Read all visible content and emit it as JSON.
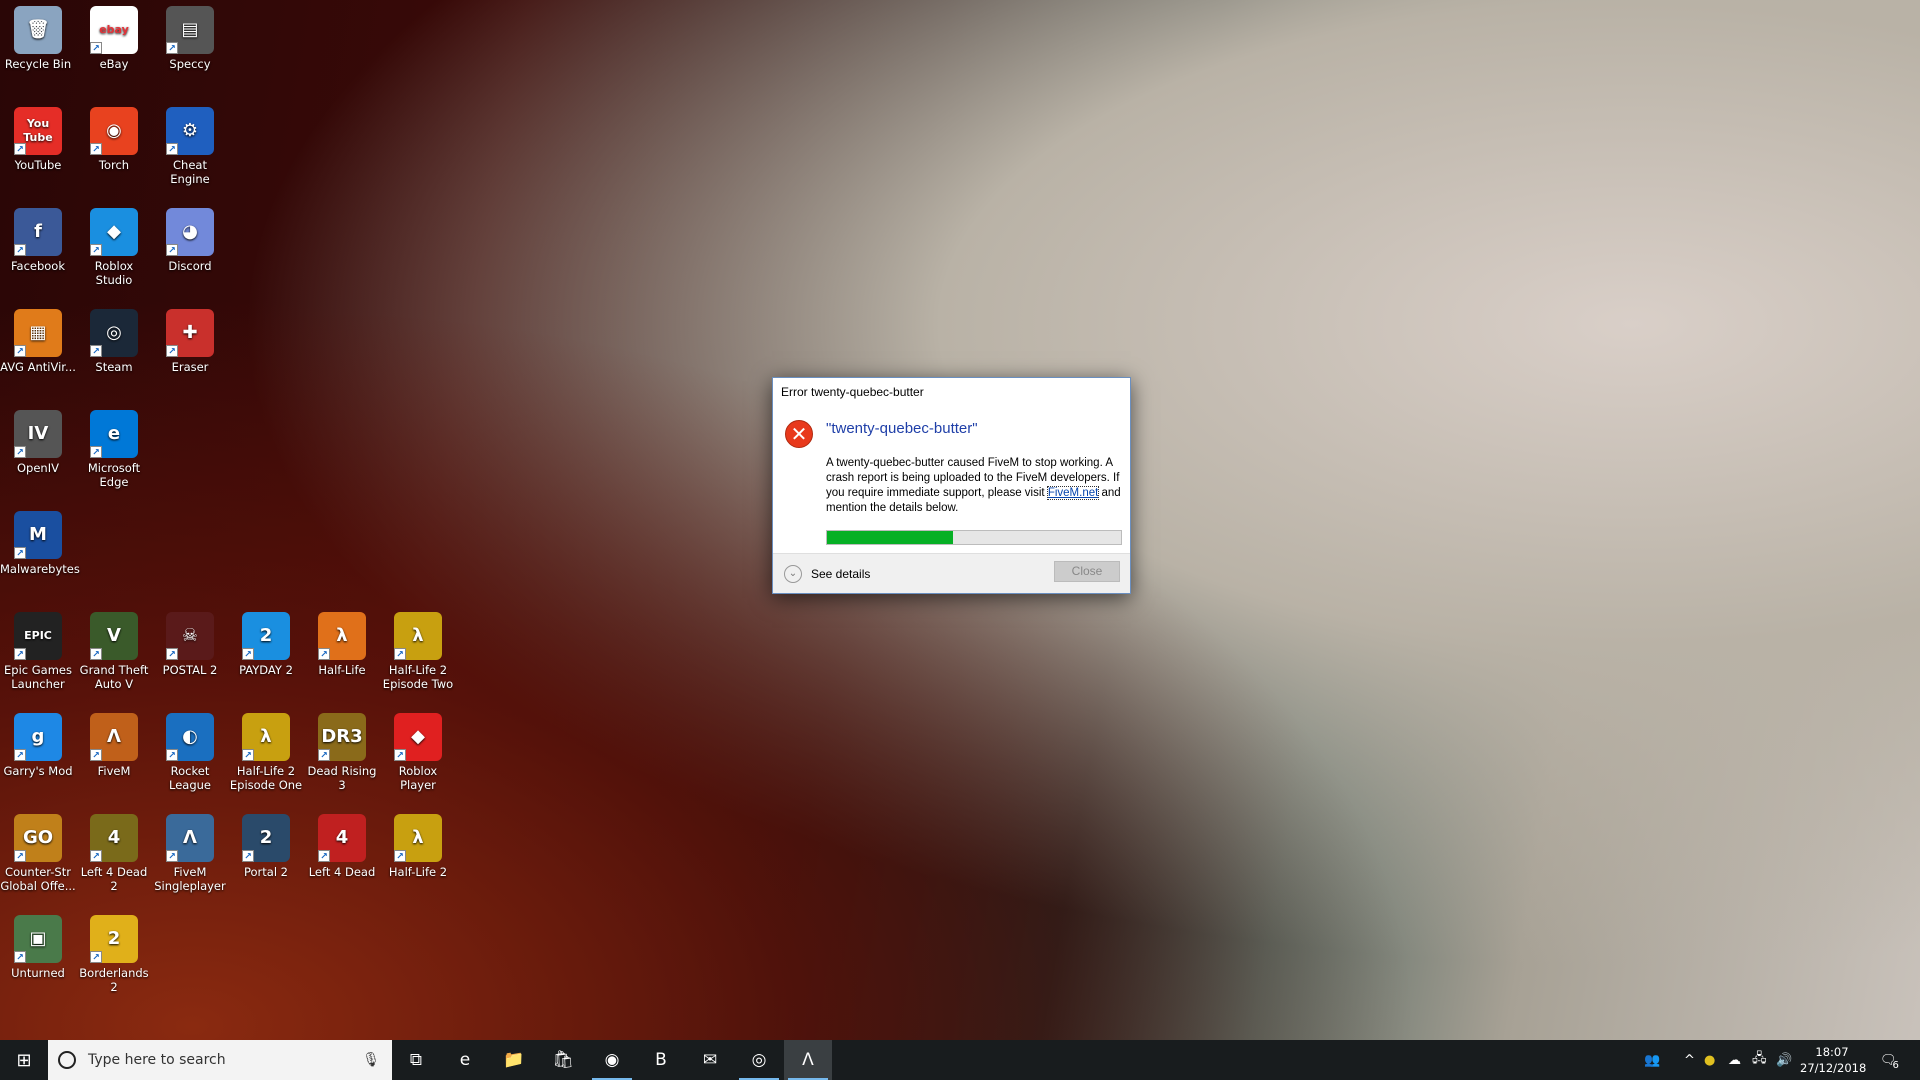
{
  "desktop_icons": [
    {
      "label": "Recycle Bin",
      "glyph": "🗑",
      "color": "#8aa4c0",
      "col": 0,
      "row": 0,
      "shortcut": false
    },
    {
      "label": "eBay",
      "glyph": "ebay",
      "color": "#ffffff",
      "col": 1,
      "row": 0,
      "shortcut": true
    },
    {
      "label": "Speccy",
      "glyph": "▤",
      "color": "#555",
      "col": 2,
      "row": 0,
      "shortcut": true
    },
    {
      "label": "YouTube",
      "glyph": "You Tube",
      "color": "#e52d27",
      "col": 0,
      "row": 1,
      "shortcut": true
    },
    {
      "label": "Torch",
      "glyph": "◉",
      "color": "#e8421f",
      "col": 1,
      "row": 1,
      "shortcut": true
    },
    {
      "label": "Cheat Engine",
      "glyph": "⚙",
      "color": "#1f5fbf",
      "col": 2,
      "row": 1,
      "shortcut": true
    },
    {
      "label": "Facebook",
      "glyph": "f",
      "color": "#3b5998",
      "col": 0,
      "row": 2,
      "shortcut": true
    },
    {
      "label": "Roblox Studio",
      "glyph": "◆",
      "color": "#1a8fe0",
      "col": 1,
      "row": 2,
      "shortcut": true
    },
    {
      "label": "Discord",
      "glyph": "◕",
      "color": "#7289da",
      "col": 2,
      "row": 2,
      "shortcut": true
    },
    {
      "label": "AVG AntiVir...",
      "glyph": "▦",
      "color": "#e07b1a",
      "col": 0,
      "row": 3,
      "shortcut": true
    },
    {
      "label": "Steam",
      "glyph": "◎",
      "color": "#1b2838",
      "col": 1,
      "row": 3,
      "shortcut": true
    },
    {
      "label": "Eraser",
      "glyph": "✚",
      "color": "#c9302c",
      "col": 2,
      "row": 3,
      "shortcut": true
    },
    {
      "label": "OpenIV",
      "glyph": "IV",
      "color": "#555",
      "col": 0,
      "row": 4,
      "shortcut": true
    },
    {
      "label": "Microsoft Edge",
      "glyph": "e",
      "color": "#0078d7",
      "col": 1,
      "row": 4,
      "shortcut": true
    },
    {
      "label": "Malwarebytes",
      "glyph": "M",
      "color": "#1a4fa0",
      "col": 0,
      "row": 5,
      "shortcut": true
    },
    {
      "label": "Epic Games Launcher",
      "glyph": "EPIC",
      "color": "#222",
      "col": 0,
      "row": 6,
      "shortcut": true
    },
    {
      "label": "Grand Theft Auto V",
      "glyph": "V",
      "color": "#3a5a2a",
      "col": 1,
      "row": 6,
      "shortcut": true
    },
    {
      "label": "POSTAL 2",
      "glyph": "☠",
      "color": "#5a1a1a",
      "col": 2,
      "row": 6,
      "shortcut": true
    },
    {
      "label": "PAYDAY 2",
      "glyph": "2",
      "color": "#1a8fe0",
      "col": 3,
      "row": 6,
      "shortcut": true
    },
    {
      "label": "Half-Life",
      "glyph": "λ",
      "color": "#e0701a",
      "col": 4,
      "row": 6,
      "shortcut": true
    },
    {
      "label": "Half-Life 2 Episode Two",
      "glyph": "λ",
      "color": "#c8a010",
      "col": 5,
      "row": 6,
      "shortcut": true
    },
    {
      "label": "Garry's Mod",
      "glyph": "g",
      "color": "#1e88e5",
      "col": 0,
      "row": 7,
      "shortcut": true
    },
    {
      "label": "FiveM",
      "glyph": "Λ",
      "color": "#c0601a",
      "col": 1,
      "row": 7,
      "shortcut": true
    },
    {
      "label": "Rocket League",
      "glyph": "◐",
      "color": "#1a6fc0",
      "col": 2,
      "row": 7,
      "shortcut": true
    },
    {
      "label": "Half-Life 2 Episode One",
      "glyph": "λ",
      "color": "#c8a010",
      "col": 3,
      "row": 7,
      "shortcut": true
    },
    {
      "label": "Dead Rising 3",
      "glyph": "DR3",
      "color": "#8a6a1a",
      "col": 4,
      "row": 7,
      "shortcut": true
    },
    {
      "label": "Roblox Player",
      "glyph": "◆",
      "color": "#e02020",
      "col": 5,
      "row": 7,
      "shortcut": true
    },
    {
      "label": "Counter-Str Global Offe...",
      "glyph": "GO",
      "color": "#c0801a",
      "col": 0,
      "row": 8,
      "shortcut": true
    },
    {
      "label": "Left 4 Dead 2",
      "glyph": "4",
      "color": "#7a6a1a",
      "col": 1,
      "row": 8,
      "shortcut": true
    },
    {
      "label": "FiveM Singleplayer",
      "glyph": "Λ",
      "color": "#3a6a9a",
      "col": 2,
      "row": 8,
      "shortcut": true
    },
    {
      "label": "Portal 2",
      "glyph": "2",
      "color": "#2a4a6a",
      "col": 3,
      "row": 8,
      "shortcut": true
    },
    {
      "label": "Left 4 Dead",
      "glyph": "4",
      "color": "#c02020",
      "col": 4,
      "row": 8,
      "shortcut": true
    },
    {
      "label": "Half-Life 2",
      "glyph": "λ",
      "color": "#c8a010",
      "col": 5,
      "row": 8,
      "shortcut": true
    },
    {
      "label": "Unturned",
      "glyph": "▣",
      "color": "#4a7a4a",
      "col": 0,
      "row": 9,
      "shortcut": true
    },
    {
      "label": "Borderlands 2",
      "glyph": "2",
      "color": "#e0b01a",
      "col": 1,
      "row": 9,
      "shortcut": true
    }
  ],
  "dialog": {
    "title": "Error twenty-quebec-butter",
    "heading": "\"twenty-quebec-butter\"",
    "message_pre": "A twenty-quebec-butter caused FiveM to stop working. A crash report is being uploaded to the FiveM developers. If you require immediate support, please visit ",
    "link": "FiveM.net",
    "message_post": " and mention the details below.",
    "progress_percent": 43,
    "progress_color": "#06b025",
    "see_details": "See details",
    "close": "Close"
  },
  "taskbar": {
    "search_placeholder": "Type here to search",
    "pinned": [
      {
        "name": "task-view",
        "glyph": "⧉",
        "open": false
      },
      {
        "name": "edge",
        "glyph": "e",
        "open": false
      },
      {
        "name": "file-explorer",
        "glyph": "📁",
        "open": false
      },
      {
        "name": "store",
        "glyph": "🛍",
        "open": false
      },
      {
        "name": "torch",
        "glyph": "◉",
        "open": true
      },
      {
        "name": "b-app",
        "glyph": "B",
        "open": false
      },
      {
        "name": "mail",
        "glyph": "✉",
        "open": false
      },
      {
        "name": "steam",
        "glyph": "◎",
        "open": true
      },
      {
        "name": "fivem",
        "glyph": "Λ",
        "open": true,
        "active": true
      }
    ],
    "time": "18:07",
    "date": "27/12/2018",
    "notification_count": "6"
  }
}
